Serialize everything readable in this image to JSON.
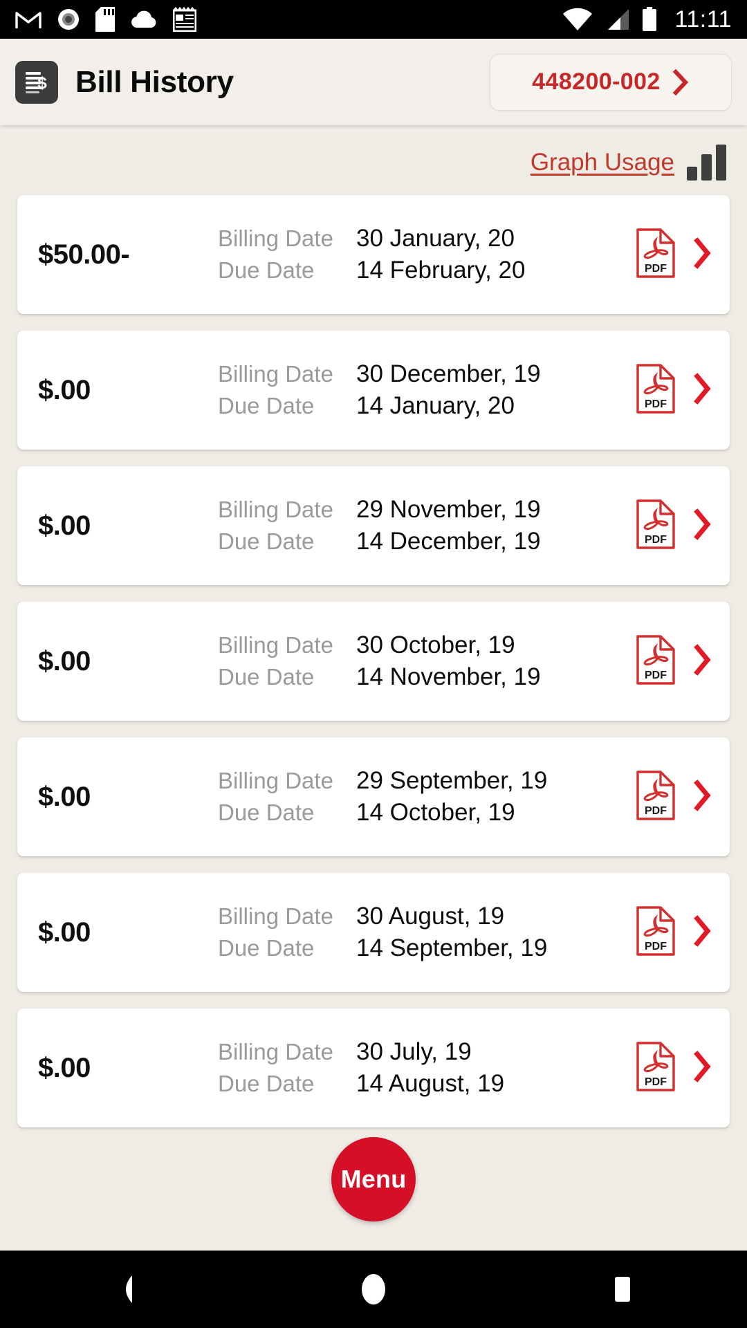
{
  "status_bar": {
    "time": "11:11",
    "left_icons": [
      "gmail-icon",
      "record-circle-icon",
      "sd-card-icon",
      "cloud-icon",
      "notepad-icon"
    ],
    "right_icons": [
      "wifi-icon",
      "cellular-signal-icon",
      "battery-icon"
    ]
  },
  "header": {
    "icon": "bill-document-icon",
    "title": "Bill History",
    "account": {
      "number": "448200-002",
      "chevron": "chevron-right-icon"
    }
  },
  "toolbar": {
    "graph_usage_label": "Graph Usage",
    "graph_icon": "bar-chart-icon"
  },
  "labels": {
    "billing_date": "Billing Date",
    "due_date": "Due Date",
    "pdf_badge": "PDF"
  },
  "colors": {
    "accent_red": "#C62828",
    "link_red": "#C0392B",
    "fab_red": "#D40F27",
    "page_bg": "#EFEBE5",
    "card_bg": "#FFFFFF",
    "label_gray": "#9A9A9A",
    "icon_dark": "#3C3C3C"
  },
  "bills": [
    {
      "amount": "$50.00-",
      "billing_date": "30 January, 20",
      "due_date": "14 February, 20"
    },
    {
      "amount": "$.00",
      "billing_date": "30 December, 19",
      "due_date": "14 January, 20"
    },
    {
      "amount": "$.00",
      "billing_date": "29 November, 19",
      "due_date": "14 December, 19"
    },
    {
      "amount": "$.00",
      "billing_date": "30 October, 19",
      "due_date": "14 November, 19"
    },
    {
      "amount": "$.00",
      "billing_date": "29 September, 19",
      "due_date": "14 October, 19"
    },
    {
      "amount": "$.00",
      "billing_date": "30 August, 19",
      "due_date": "14 September, 19"
    },
    {
      "amount": "$.00",
      "billing_date": "30 July, 19",
      "due_date": "14 August, 19"
    }
  ],
  "fab": {
    "label": "Menu"
  },
  "nav_bar": {
    "back": "back-triangle-icon",
    "home": "home-circle-icon",
    "recents": "recents-square-icon"
  }
}
